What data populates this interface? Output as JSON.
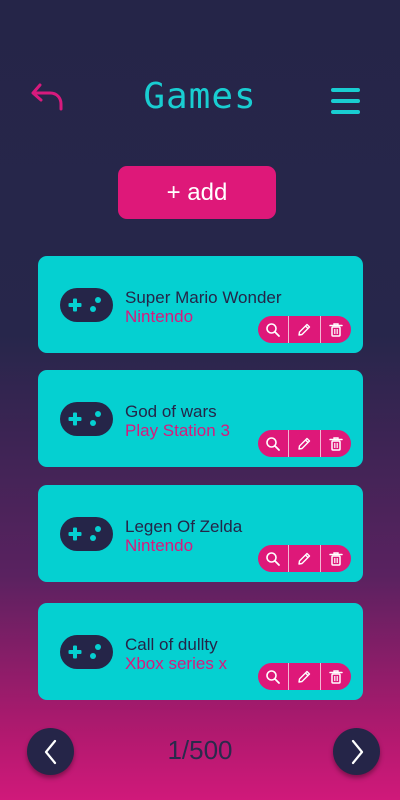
{
  "header": {
    "title": "Games",
    "back_icon": "back-arrow-icon",
    "menu_icon": "hamburger-menu-icon"
  },
  "add_button": {
    "label": "+ add"
  },
  "games": [
    {
      "title": "Super Mario Wonder",
      "platform": "Nintendo"
    },
    {
      "title": "God of wars",
      "platform": "Play Station 3"
    },
    {
      "title": "Legen Of Zelda",
      "platform": "Nintendo"
    },
    {
      "title": "Call of dullty",
      "platform": "Xbox series x"
    }
  ],
  "card_actions": [
    "search-icon",
    "edit-pencil-icon",
    "trash-icon"
  ],
  "pagination": {
    "label": "1/500"
  },
  "colors": {
    "background_top": "#252548",
    "background_bottom": "#d0197a",
    "accent_pink": "#de1879",
    "accent_teal": "#05d0d1",
    "title_teal": "#19cdd1",
    "dark_navy": "#252548"
  }
}
